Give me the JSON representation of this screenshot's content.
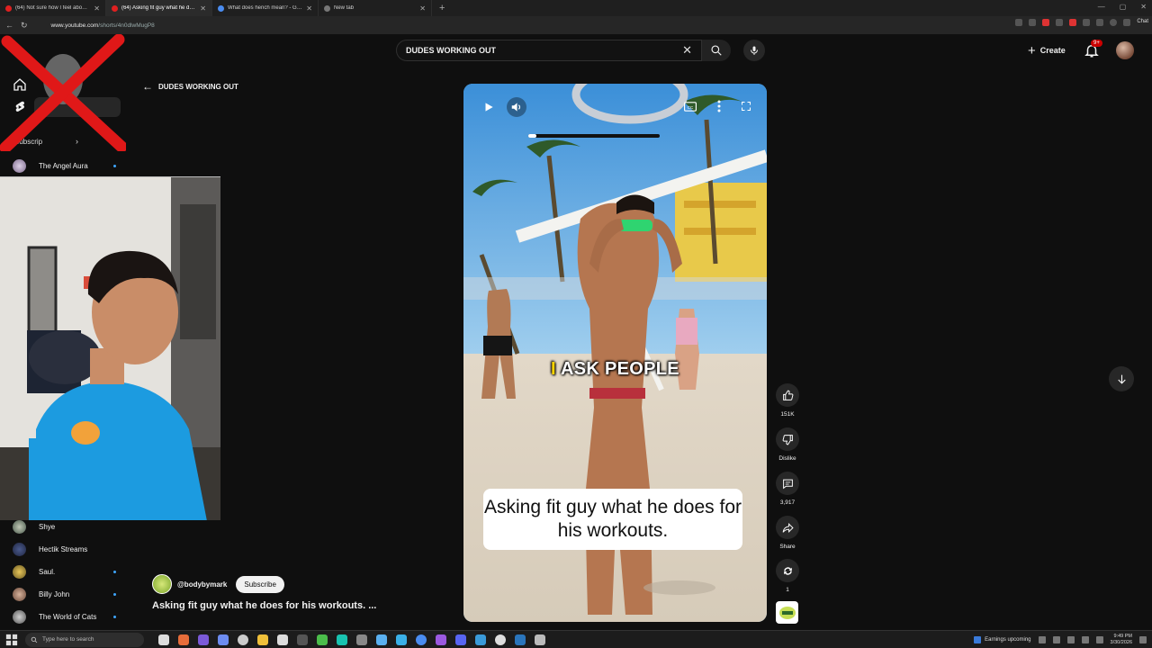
{
  "browser": {
    "tabs": [
      {
        "title": "(64) Not sure how I feel about the"
      },
      {
        "title": "(64) Asking fit guy what he does fo"
      },
      {
        "title": "What does hench mean? - Google"
      },
      {
        "title": "New tab"
      }
    ],
    "url_host": "www.youtube.com",
    "url_path": "/shorts/4n0dlwMugP8",
    "chat_label": "Chat"
  },
  "header": {
    "search_query": "DUDES WORKING OUT",
    "create_label": "Create",
    "notif_badge": "9+"
  },
  "sidebar": {
    "subscriptions_label": "Subscrip",
    "channels_top": [
      {
        "name": "The Angel Aura"
      }
    ],
    "channels_bottom": [
      {
        "name": "Shye"
      },
      {
        "name": "Hectik Streams"
      },
      {
        "name": "Saul."
      },
      {
        "name": "Billy John"
      },
      {
        "name": "The World of Cats"
      }
    ]
  },
  "back_link": "DUDES WORKING OUT",
  "video": {
    "caption_top_highlight": "I",
    "caption_top_rest": "ASK PEOPLE",
    "caption_box": "Asking fit guy what he does for his workouts.",
    "progress": 0.06
  },
  "actions": {
    "likes": "151K",
    "dislike": "Dislike",
    "comments": "3,917",
    "share": "Share",
    "remix": "1"
  },
  "channel": {
    "handle": "@bodybymark",
    "subscribe_label": "Subscribe",
    "title": "Asking fit guy what he does for his workouts. ..."
  },
  "taskbar": {
    "search_placeholder": "Type here to search",
    "earnings": "Earnings upcoming",
    "time": "9:49 PM",
    "date": "3/30/2026"
  },
  "colors": {
    "accent": "#3ea6ff",
    "brand_red": "#cc0000",
    "bg": "#0f0f0f"
  }
}
